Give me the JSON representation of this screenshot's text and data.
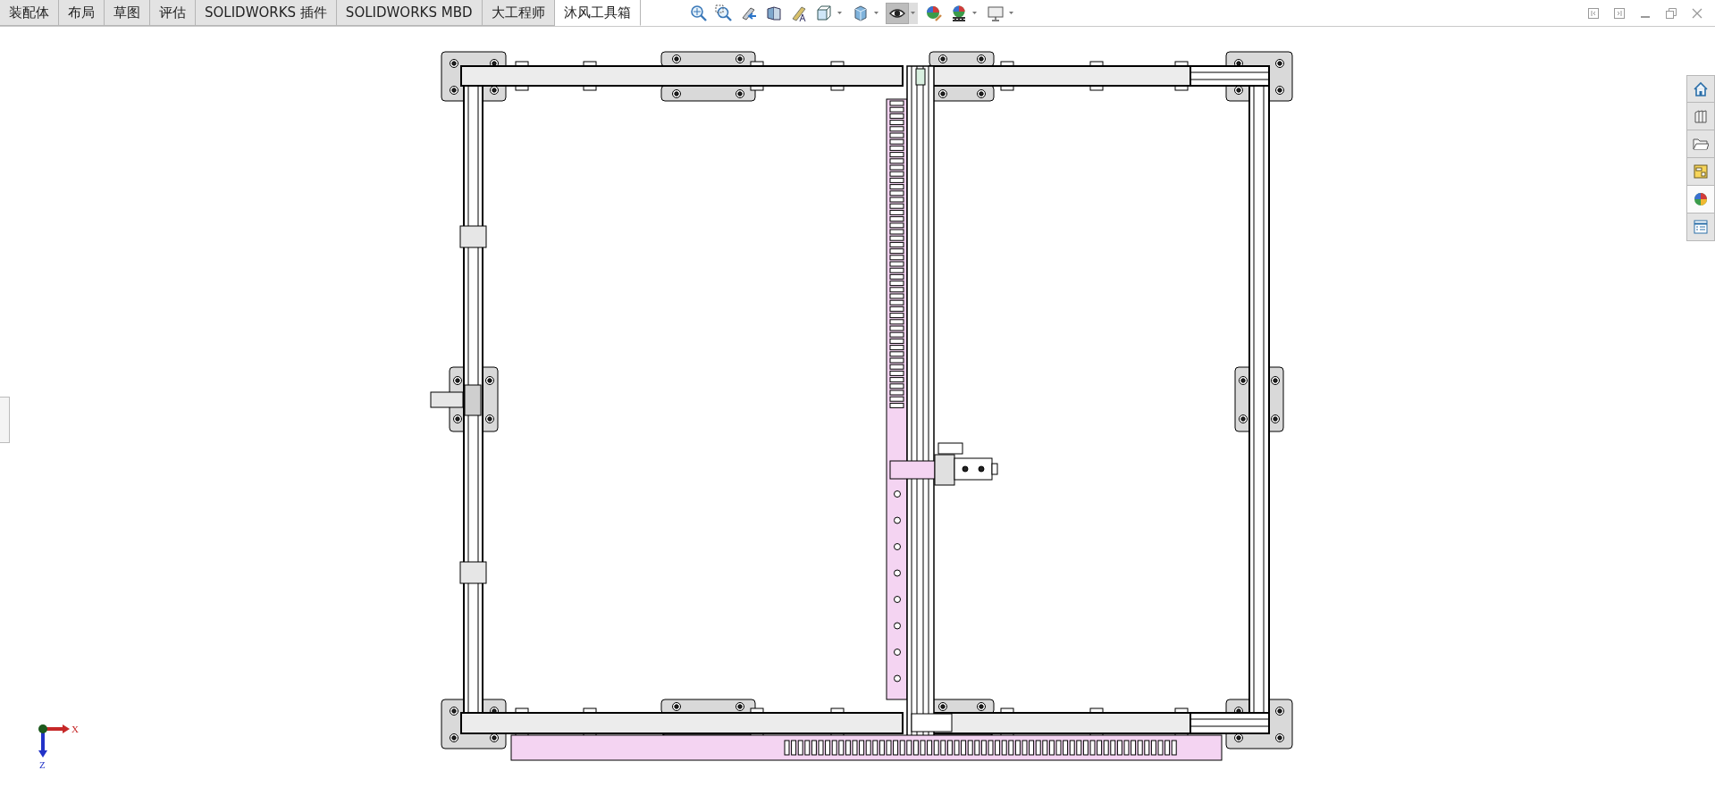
{
  "tabs": [
    {
      "label": "装配体",
      "selected": false
    },
    {
      "label": "布局",
      "selected": false
    },
    {
      "label": "草图",
      "selected": false
    },
    {
      "label": "评估",
      "selected": false
    },
    {
      "label": "SOLIDWORKS 插件",
      "selected": false
    },
    {
      "label": "SOLIDWORKS MBD",
      "selected": false
    },
    {
      "label": "大工程师",
      "selected": false
    },
    {
      "label": "沐风工具箱",
      "selected": true
    }
  ],
  "view_toolbar": [
    {
      "kind": "zoom-fit",
      "selected": false,
      "has_menu": false
    },
    {
      "kind": "zoom-area",
      "selected": false,
      "has_menu": false
    },
    {
      "kind": "previous-view",
      "selected": false,
      "has_menu": false
    },
    {
      "kind": "section",
      "selected": false,
      "has_menu": false
    },
    {
      "kind": "dynamic",
      "selected": false,
      "has_menu": false
    },
    {
      "kind": "orientation",
      "selected": false,
      "has_menu": true
    },
    {
      "kind": "display-style",
      "selected": false,
      "has_menu": true
    },
    {
      "kind": "hide-show",
      "selected": true,
      "has_menu": true
    },
    {
      "kind": "appearance",
      "selected": false,
      "has_menu": false
    },
    {
      "kind": "scene",
      "selected": false,
      "has_menu": true
    },
    {
      "kind": "display",
      "selected": false,
      "has_menu": true
    }
  ],
  "task_pane": [
    {
      "kind": "home",
      "selected": false
    },
    {
      "kind": "library",
      "selected": false
    },
    {
      "kind": "explorer",
      "selected": false
    },
    {
      "kind": "palette",
      "selected": false
    },
    {
      "kind": "appearances",
      "selected": true
    },
    {
      "kind": "properties",
      "selected": false
    }
  ],
  "triad": {
    "x_label": "X",
    "z_label": "Z"
  }
}
